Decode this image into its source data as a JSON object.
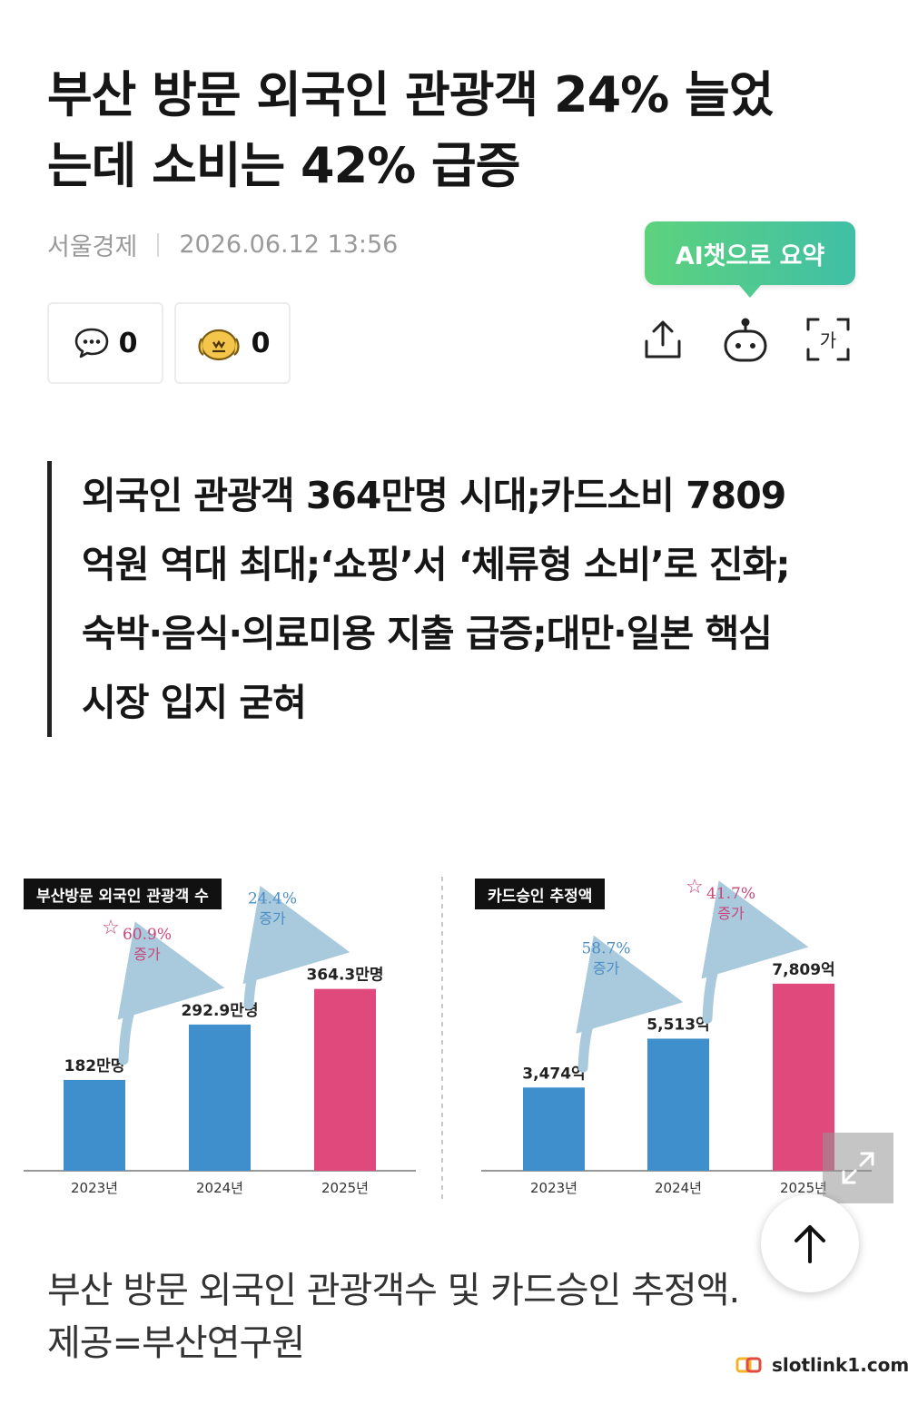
{
  "article": {
    "title_line1": "부산 방문 외국인 관광객 24% 늘었",
    "title_line2": "는데 소비는 42% 급증",
    "source": "서울경제",
    "datetime": "2026.06.12 13:56",
    "ai_button_label": "AI챗으로 요약",
    "comment_count": "0",
    "like_count": "0",
    "font_icon_glyph": "가",
    "summary_lines": [
      "외국인 관광객 364만명 시대;카드소비 7809",
      "억원 역대 최대;‘쇼핑’서 ‘체류형 소비’로 진화;",
      "숙박·음식·의료미용 지출 급증;대만·일본 핵심",
      "시장 입지 굳혀"
    ],
    "caption_line1": "부산 방문 외국인 관광객수 및 카드승인 추정액.",
    "caption_line2": "제공=부산연구원",
    "watermark": "slotlink1.com"
  },
  "icons": [
    "comment-icon",
    "like-face-icon",
    "share-icon",
    "ai-bot-icon",
    "font-size-icon",
    "expand-icon",
    "arrow-up-icon",
    "star-icon",
    "curved-arrow-icon"
  ],
  "colors": {
    "bar_blue": "#3f8fcd",
    "bar_pink": "#e0497c",
    "ai_green": "#4fca90",
    "pink_annotation": "#c9457a",
    "blue_annotation": "#4b8fc6"
  },
  "chart_data": [
    {
      "type": "bar",
      "title": "부산방문 외국인 관광객 수",
      "categories": [
        "2023년",
        "2024년",
        "2025년"
      ],
      "values": [
        182,
        292.9,
        364.3
      ],
      "value_labels": [
        "182만명",
        "292.9만명",
        "364.3만명"
      ],
      "growth": [
        {
          "rate": "60.9%",
          "label": "증가"
        },
        {
          "rate": "24.4%",
          "label": "증가"
        }
      ]
    },
    {
      "type": "bar",
      "title": "카드승인 추정액",
      "categories": [
        "2023년",
        "2024년",
        "2025년"
      ],
      "values": [
        3474,
        5513,
        7809
      ],
      "value_labels": [
        "3,474억",
        "5,513억",
        "7,809억"
      ],
      "growth": [
        {
          "rate": "58.7%",
          "label": "증가"
        },
        {
          "rate": "41.7%",
          "label": "증가"
        }
      ]
    }
  ]
}
